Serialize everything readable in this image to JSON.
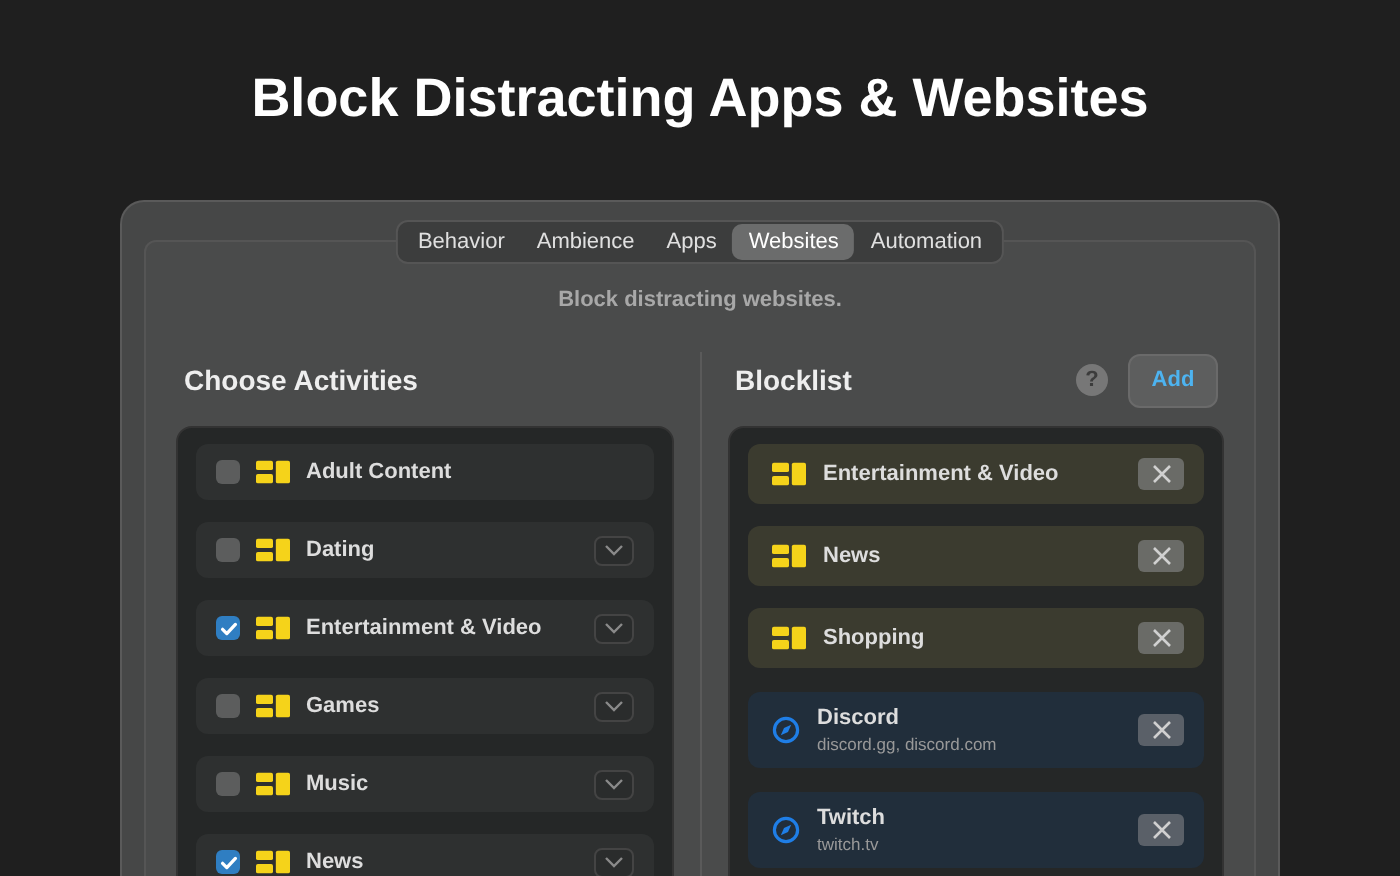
{
  "headline": "Block Distracting Apps & Websites",
  "tabs": [
    {
      "label": "Behavior",
      "selected": false
    },
    {
      "label": "Ambience",
      "selected": false
    },
    {
      "label": "Apps",
      "selected": false
    },
    {
      "label": "Websites",
      "selected": true
    },
    {
      "label": "Automation",
      "selected": false
    }
  ],
  "subtitle": "Block distracting websites.",
  "activities": {
    "title": "Choose Activities",
    "items": [
      {
        "label": "Adult Content",
        "checked": false,
        "expandable": false
      },
      {
        "label": "Dating",
        "checked": false,
        "expandable": true
      },
      {
        "label": "Entertainment & Video",
        "checked": true,
        "expandable": true
      },
      {
        "label": "Games",
        "checked": false,
        "expandable": true
      },
      {
        "label": "Music",
        "checked": false,
        "expandable": true
      },
      {
        "label": "News",
        "checked": true,
        "expandable": true
      }
    ]
  },
  "blocklist": {
    "title": "Blocklist",
    "help": "?",
    "add_button": "Add",
    "items": [
      {
        "kind": "category",
        "label": "Entertainment & Video"
      },
      {
        "kind": "category",
        "label": "News"
      },
      {
        "kind": "category",
        "label": "Shopping"
      },
      {
        "kind": "website",
        "label": "Discord",
        "detail": "discord.gg, discord.com"
      },
      {
        "kind": "website",
        "label": "Twitch",
        "detail": "twitch.tv"
      }
    ]
  }
}
